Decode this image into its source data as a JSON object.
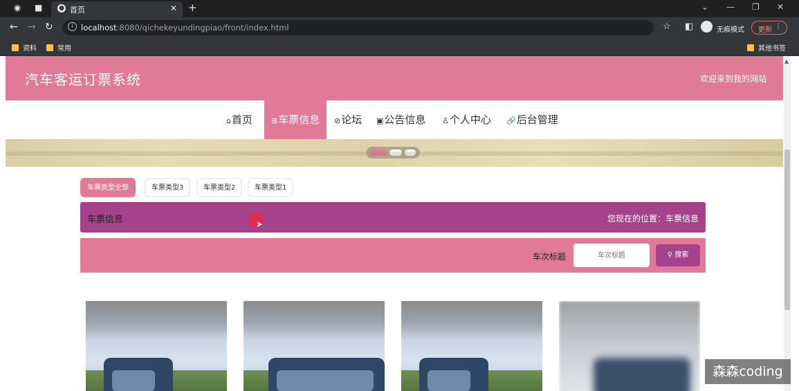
{
  "browser": {
    "tab_title": "首页",
    "url_host": "localhost",
    "url_rest": ":8080/qichekeyundingpiao/front/index.html",
    "incognito_label": "无痕模式",
    "update_label": "更新",
    "bookmarks": [
      "资料",
      "常用"
    ],
    "other_bookmarks": "其他书签"
  },
  "site": {
    "title": "汽车客运订票系统",
    "welcome": "欢迎来到我的网站"
  },
  "menu": [
    {
      "icon": "⌂",
      "label": "首页"
    },
    {
      "icon": "⊞",
      "label": "车票信息"
    },
    {
      "icon": "⊘",
      "label": "论坛"
    },
    {
      "icon": "▣",
      "label": "公告信息"
    },
    {
      "icon": "♙",
      "label": "个人中心"
    },
    {
      "icon": "🔗",
      "label": "后台管理"
    }
  ],
  "banner": {
    "active_dot": 0,
    "dot_count": 3
  },
  "filters": [
    "车票类型全部",
    "车票类型3",
    "车票类型2",
    "车票类型1"
  ],
  "breadcrumb": {
    "title": "车票信息",
    "location": "您现在的位置：车票信息"
  },
  "search": {
    "label": "车次标题",
    "placeholder": "车次标题",
    "button": "搜索"
  },
  "watermark": "森森coding",
  "colors": {
    "primary": "#e07a98",
    "secondary": "#a6418c"
  }
}
